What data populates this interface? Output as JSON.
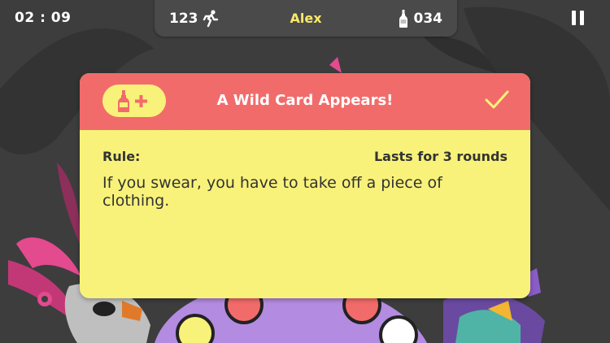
{
  "status_bar": {
    "timer": "02 : 09",
    "steps_count": "123",
    "player_name": "Alex",
    "bottle_count": "034"
  },
  "card": {
    "title": "A Wild Card Appears!",
    "rule_label": "Rule:",
    "duration": "Lasts for 3 rounds",
    "rule_text": "If you swear, you have to take off a piece of clothing."
  },
  "colors": {
    "background": "#3d3d3d",
    "topbar": "#4a4a4a",
    "card_header": "#f26b6b",
    "card_body": "#f8f27a",
    "player_name": "#f7e96a"
  },
  "icons": [
    "runner-icon",
    "bottle-icon",
    "pause-icon",
    "bottle-plus-icon",
    "checkmark-icon"
  ]
}
